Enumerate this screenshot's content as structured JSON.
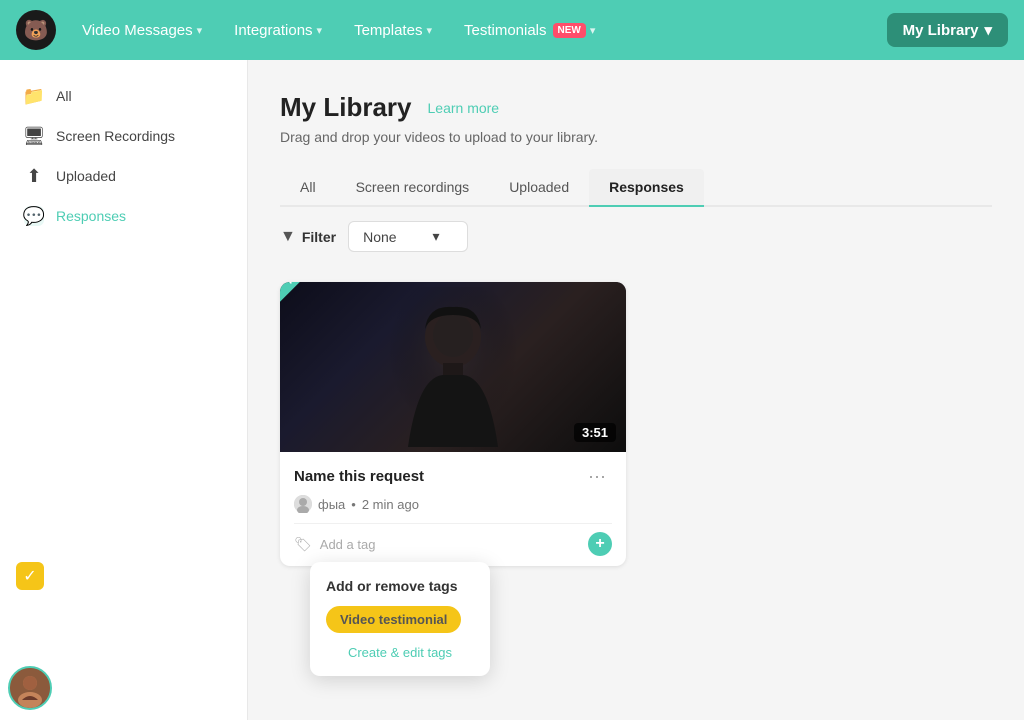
{
  "navbar": {
    "logo_emoji": "🐻",
    "items": [
      {
        "label": "Video Messages",
        "id": "video-messages"
      },
      {
        "label": "Integrations",
        "id": "integrations"
      },
      {
        "label": "Templates",
        "id": "templates"
      },
      {
        "label": "Testimonials",
        "id": "testimonials",
        "badge": "NEW"
      },
      {
        "label": "My Library",
        "id": "my-library"
      }
    ]
  },
  "sidebar": {
    "items": [
      {
        "label": "All",
        "id": "all",
        "icon": "📁",
        "active": false
      },
      {
        "label": "Screen Recordings",
        "id": "screen-recordings",
        "icon": "🖥",
        "active": false
      },
      {
        "label": "Uploaded",
        "id": "uploaded",
        "icon": "⬆",
        "active": false
      },
      {
        "label": "Responses",
        "id": "responses",
        "icon": "💬",
        "active": true
      }
    ]
  },
  "page": {
    "title": "My Library",
    "learn_more": "Learn more",
    "subtitle": "Drag and drop your videos to upload to your library.",
    "tabs": [
      {
        "label": "All",
        "id": "all",
        "active": false
      },
      {
        "label": "Screen recordings",
        "id": "screen-recordings",
        "active": false
      },
      {
        "label": "Uploaded",
        "id": "uploaded",
        "active": false
      },
      {
        "label": "Responses",
        "id": "responses",
        "active": true
      }
    ],
    "filter": {
      "label": "Filter",
      "value": "None"
    }
  },
  "video_card": {
    "title": "Name this request",
    "duration": "3:51",
    "new_badge": "New",
    "user": "фыа",
    "time_ago": "2 min ago",
    "add_tag_placeholder": "Add a tag"
  },
  "tag_dropdown": {
    "title": "Add or remove tags",
    "existing_tag": "Video testimonial",
    "create_edit": "Create & edit tags"
  }
}
